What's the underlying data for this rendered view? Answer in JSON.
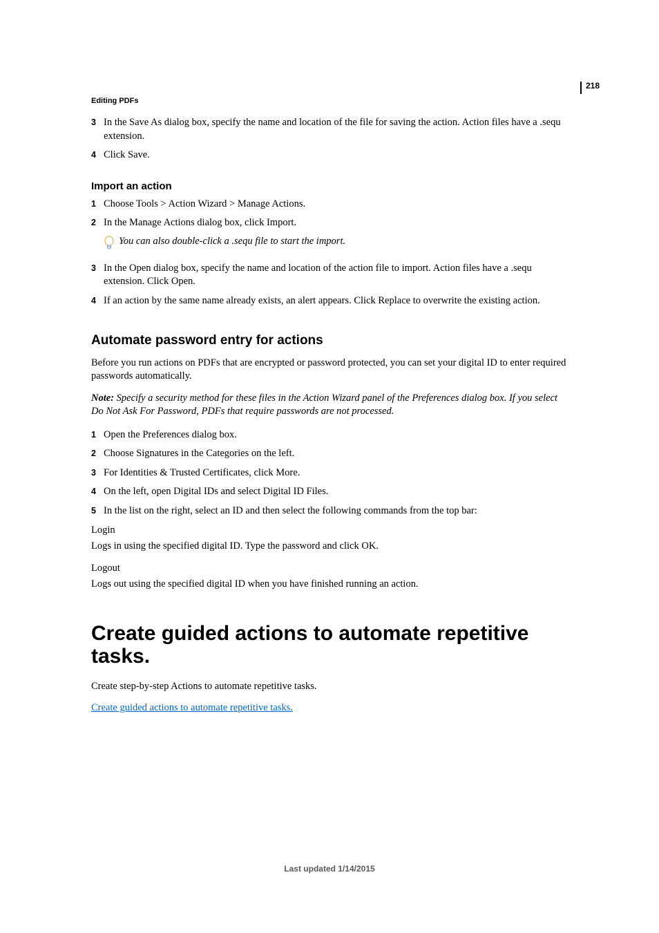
{
  "page_number": "218",
  "running_head": "Editing PDFs",
  "section_a": {
    "items": [
      {
        "num": "3",
        "text": "In the Save As dialog box, specify the name and location of the file for saving the action. Action files have a .sequ extension."
      },
      {
        "num": "4",
        "text": "Click Save."
      }
    ]
  },
  "import": {
    "heading": "Import an action",
    "items_top": [
      {
        "num": "1",
        "text": "Choose Tools > Action Wizard > Manage Actions."
      },
      {
        "num": "2",
        "text": "In the Manage Actions dialog box, click Import."
      }
    ],
    "tip": "You can also double-click a .sequ file to start the import.",
    "items_bottom": [
      {
        "num": "3",
        "text": "In the Open dialog box, specify the name and location of the action file to import. Action files have a .sequ extension. Click Open."
      },
      {
        "num": "4",
        "text": "If an action by the same name already exists, an alert appears. Click Replace to overwrite the existing action."
      }
    ]
  },
  "automate": {
    "heading": "Automate password entry for actions",
    "intro": "Before you run actions on PDFs that are encrypted or password protected, you can set your digital ID to enter required passwords automatically.",
    "note_label": "Note:",
    "note_body": "Specify a security method for these files in the Action Wizard panel of the Preferences dialog box. If you select Do Not Ask For Password, PDFs that require passwords are not processed.",
    "items": [
      {
        "num": "1",
        "text": "Open the Preferences dialog box."
      },
      {
        "num": "2",
        "text": "Choose Signatures in the Categories on the left."
      },
      {
        "num": "3",
        "text": "For Identities & Trusted Certificates, click More."
      },
      {
        "num": "4",
        "text": "On the left, open Digital IDs and select Digital ID Files."
      },
      {
        "num": "5",
        "text": "In the list on the right, select an ID and then select the following commands from the top bar:"
      }
    ],
    "login_term": "Login",
    "login_desc": "Logs in using the specified digital ID. Type the password and click OK.",
    "logout_term": "Logout",
    "logout_desc": "Logs out using the specified digital ID when you have finished running an action."
  },
  "guided": {
    "heading": "Create guided actions to automate repetitive tasks.",
    "intro": "Create step-by-step Actions to automate repetitive tasks.",
    "link": "Create guided actions to automate repetitive tasks."
  },
  "footer": "Last updated 1/14/2015"
}
